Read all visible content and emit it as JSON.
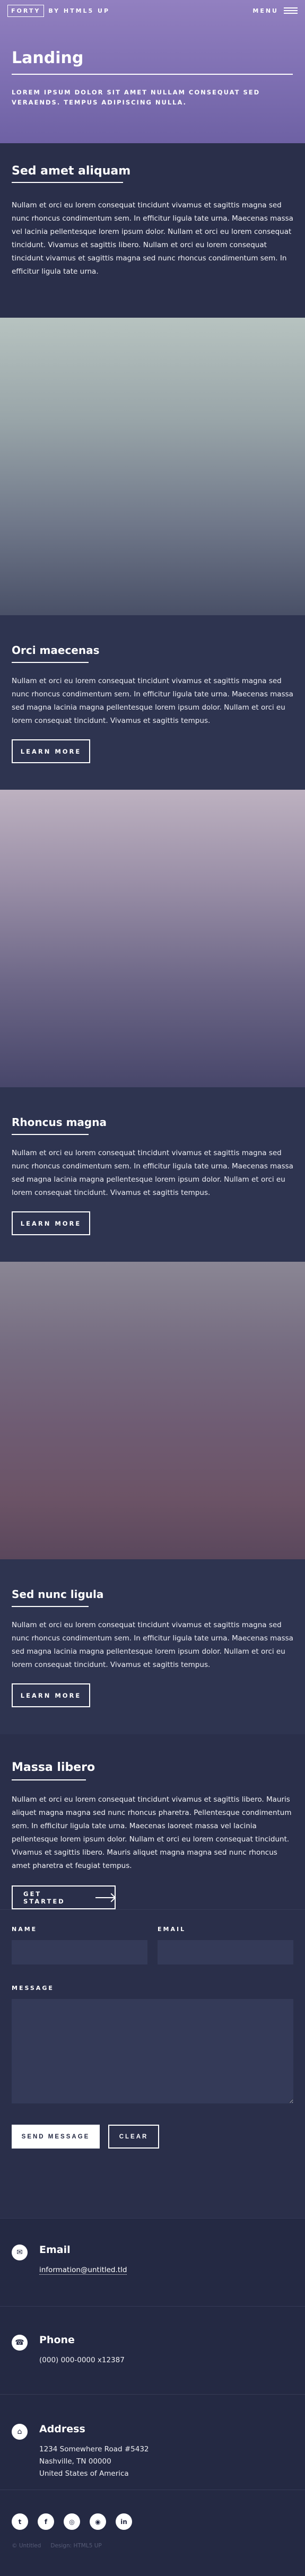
{
  "header": {
    "logo_box": "FORTY",
    "logo_rest": "BY HTML5 UP",
    "menu_label": "MENU"
  },
  "banner": {
    "title": "Landing",
    "subtitle": "LOREM IPSUM DOLOR SIT AMET NULLAM CONSEQUAT SED VERAENDS. TEMPUS ADIPISCING NULLA."
  },
  "intro": {
    "title": "Sed amet aliquam",
    "text": "Nullam et orci eu lorem consequat tincidunt vivamus et sagittis magna sed nunc rhoncus condimentum sem. In efficitur ligula tate urna. Maecenas massa vel lacinia pellentesque lorem ipsum dolor. Nullam et orci eu lorem consequat tincidunt. Vivamus et sagittis libero. Nullam et orci eu lorem consequat tincidunt vivamus et sagittis magna sed nunc rhoncus condimentum sem. In efficitur ligula tate urna."
  },
  "tiles": [
    {
      "title": "Orci maecenas",
      "text": "Nullam et orci eu lorem consequat tincidunt vivamus et sagittis magna sed nunc rhoncus condimentum sem. In efficitur ligula tate urna. Maecenas massa sed magna lacinia magna pellentesque lorem ipsum dolor. Nullam et orci eu lorem consequat tincidunt. Vivamus et sagittis tempus.",
      "button": "LEARN MORE"
    },
    {
      "title": "Rhoncus magna",
      "text": "Nullam et orci eu lorem consequat tincidunt vivamus et sagittis magna sed nunc rhoncus condimentum sem. In efficitur ligula tate urna. Maecenas massa sed magna lacinia magna pellentesque lorem ipsum dolor. Nullam et orci eu lorem consequat tincidunt. Vivamus et sagittis tempus.",
      "button": "LEARN MORE"
    },
    {
      "title": "Sed nunc ligula",
      "text": "Nullam et orci eu lorem consequat tincidunt vivamus et sagittis magna sed nunc rhoncus condimentum sem. In efficitur ligula tate urna. Maecenas massa sed magna lacinia magna pellentesque lorem ipsum dolor. Nullam et orci eu lorem consequat tincidunt. Vivamus et sagittis tempus.",
      "button": "LEARN MORE"
    }
  ],
  "massa": {
    "title": "Massa libero",
    "text": "Nullam et orci eu lorem consequat tincidunt vivamus et sagittis libero. Mauris aliquet magna magna sed nunc rhoncus pharetra. Pellentesque condimentum sem. In efficitur ligula tate urna. Maecenas laoreet massa vel lacinia pellentesque lorem ipsum dolor. Nullam et orci eu lorem consequat tincidunt. Vivamus et sagittis libero. Mauris aliquet magna magna sed nunc rhoncus amet pharetra et feugiat tempus.",
    "button": "GET STARTED"
  },
  "form": {
    "name_label": "NAME",
    "email_label": "EMAIL",
    "message_label": "MESSAGE",
    "send_label": "SEND MESSAGE",
    "clear_label": "CLEAR"
  },
  "contact": {
    "email_title": "Email",
    "email_value": "information@untitled.tld",
    "phone_title": "Phone",
    "phone_value": "(000) 000-0000 x12387",
    "address_title": "Address",
    "address_lines": [
      "1234 Somewhere Road #5432",
      "Nashville, TN 00000",
      "United States of America"
    ]
  },
  "social": [
    "twitter-icon",
    "facebook-icon",
    "instagram-icon",
    "github-icon",
    "linkedin-icon"
  ],
  "footer": {
    "copyright": "© Untitled",
    "design": "Design: HTML5 UP"
  }
}
